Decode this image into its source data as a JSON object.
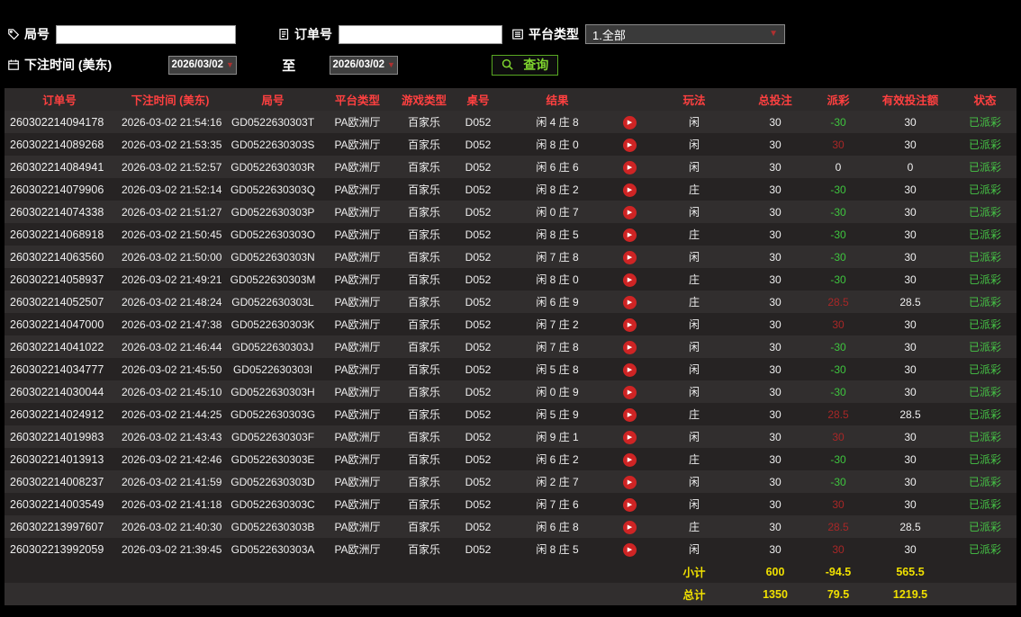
{
  "colors": {
    "header_text": "#ff4040",
    "win": "#a82727",
    "loss": "#3ec43e",
    "status": "#46c446",
    "footer": "#f0e000",
    "accent_green": "#7fd42e",
    "arrow_red": "#b03030"
  },
  "icons": {
    "dropdown_arrow": "▼",
    "play": "▶"
  },
  "filters": {
    "round": {
      "label": "局号",
      "value": ""
    },
    "order": {
      "label": "订单号",
      "value": ""
    },
    "platform": {
      "label": "平台类型",
      "value": "1.全部"
    },
    "bet_time": {
      "label": "下注时间 (美东)",
      "from": "2026/03/02",
      "to_label": "至",
      "to": "2026/03/02"
    },
    "query_label": "查询"
  },
  "table": {
    "headers": [
      "订单号",
      "下注时间 (美东)",
      "局号",
      "平台类型",
      "游戏类型",
      "桌号",
      "结果",
      "玩法",
      "总投注",
      "派彩",
      "有效投注额",
      "状态"
    ],
    "rows": [
      {
        "order": "260302214094178",
        "time": "2026-03-02 21:54:16",
        "round": "GD0522630303T",
        "platform": "PA欧洲厅",
        "game": "百家乐",
        "table": "D052",
        "result": "闲 4 庄 8",
        "play": "闲",
        "bet": "30",
        "payout": "-30",
        "valid": "30",
        "status": "已派彩"
      },
      {
        "order": "260302214089268",
        "time": "2026-03-02 21:53:35",
        "round": "GD0522630303S",
        "platform": "PA欧洲厅",
        "game": "百家乐",
        "table": "D052",
        "result": "闲 8 庄 0",
        "play": "闲",
        "bet": "30",
        "payout": "30",
        "valid": "30",
        "status": "已派彩"
      },
      {
        "order": "260302214084941",
        "time": "2026-03-02 21:52:57",
        "round": "GD0522630303R",
        "platform": "PA欧洲厅",
        "game": "百家乐",
        "table": "D052",
        "result": "闲 6 庄 6",
        "play": "闲",
        "bet": "30",
        "payout": "0",
        "valid": "0",
        "status": "已派彩"
      },
      {
        "order": "260302214079906",
        "time": "2026-03-02 21:52:14",
        "round": "GD0522630303Q",
        "platform": "PA欧洲厅",
        "game": "百家乐",
        "table": "D052",
        "result": "闲 8 庄 2",
        "play": "庄",
        "bet": "30",
        "payout": "-30",
        "valid": "30",
        "status": "已派彩"
      },
      {
        "order": "260302214074338",
        "time": "2026-03-02 21:51:27",
        "round": "GD0522630303P",
        "platform": "PA欧洲厅",
        "game": "百家乐",
        "table": "D052",
        "result": "闲 0 庄 7",
        "play": "闲",
        "bet": "30",
        "payout": "-30",
        "valid": "30",
        "status": "已派彩"
      },
      {
        "order": "260302214068918",
        "time": "2026-03-02 21:50:45",
        "round": "GD0522630303O",
        "platform": "PA欧洲厅",
        "game": "百家乐",
        "table": "D052",
        "result": "闲 8 庄 5",
        "play": "庄",
        "bet": "30",
        "payout": "-30",
        "valid": "30",
        "status": "已派彩"
      },
      {
        "order": "260302214063560",
        "time": "2026-03-02 21:50:00",
        "round": "GD0522630303N",
        "platform": "PA欧洲厅",
        "game": "百家乐",
        "table": "D052",
        "result": "闲 7 庄 8",
        "play": "闲",
        "bet": "30",
        "payout": "-30",
        "valid": "30",
        "status": "已派彩"
      },
      {
        "order": "260302214058937",
        "time": "2026-03-02 21:49:21",
        "round": "GD0522630303M",
        "platform": "PA欧洲厅",
        "game": "百家乐",
        "table": "D052",
        "result": "闲 8 庄 0",
        "play": "庄",
        "bet": "30",
        "payout": "-30",
        "valid": "30",
        "status": "已派彩"
      },
      {
        "order": "260302214052507",
        "time": "2026-03-02 21:48:24",
        "round": "GD0522630303L",
        "platform": "PA欧洲厅",
        "game": "百家乐",
        "table": "D052",
        "result": "闲 6 庄 9",
        "play": "庄",
        "bet": "30",
        "payout": "28.5",
        "valid": "28.5",
        "status": "已派彩"
      },
      {
        "order": "260302214047000",
        "time": "2026-03-02 21:47:38",
        "round": "GD0522630303K",
        "platform": "PA欧洲厅",
        "game": "百家乐",
        "table": "D052",
        "result": "闲 7 庄 2",
        "play": "闲",
        "bet": "30",
        "payout": "30",
        "valid": "30",
        "status": "已派彩"
      },
      {
        "order": "260302214041022",
        "time": "2026-03-02 21:46:44",
        "round": "GD0522630303J",
        "platform": "PA欧洲厅",
        "game": "百家乐",
        "table": "D052",
        "result": "闲 7 庄 8",
        "play": "闲",
        "bet": "30",
        "payout": "-30",
        "valid": "30",
        "status": "已派彩"
      },
      {
        "order": "260302214034777",
        "time": "2026-03-02 21:45:50",
        "round": "GD0522630303I",
        "platform": "PA欧洲厅",
        "game": "百家乐",
        "table": "D052",
        "result": "闲 5 庄 8",
        "play": "闲",
        "bet": "30",
        "payout": "-30",
        "valid": "30",
        "status": "已派彩"
      },
      {
        "order": "260302214030044",
        "time": "2026-03-02 21:45:10",
        "round": "GD0522630303H",
        "platform": "PA欧洲厅",
        "game": "百家乐",
        "table": "D052",
        "result": "闲 0 庄 9",
        "play": "闲",
        "bet": "30",
        "payout": "-30",
        "valid": "30",
        "status": "已派彩"
      },
      {
        "order": "260302214024912",
        "time": "2026-03-02 21:44:25",
        "round": "GD0522630303G",
        "platform": "PA欧洲厅",
        "game": "百家乐",
        "table": "D052",
        "result": "闲 5 庄 9",
        "play": "庄",
        "bet": "30",
        "payout": "28.5",
        "valid": "28.5",
        "status": "已派彩"
      },
      {
        "order": "260302214019983",
        "time": "2026-03-02 21:43:43",
        "round": "GD0522630303F",
        "platform": "PA欧洲厅",
        "game": "百家乐",
        "table": "D052",
        "result": "闲 9 庄 1",
        "play": "闲",
        "bet": "30",
        "payout": "30",
        "valid": "30",
        "status": "已派彩"
      },
      {
        "order": "260302214013913",
        "time": "2026-03-02 21:42:46",
        "round": "GD0522630303E",
        "platform": "PA欧洲厅",
        "game": "百家乐",
        "table": "D052",
        "result": "闲 6 庄 2",
        "play": "庄",
        "bet": "30",
        "payout": "-30",
        "valid": "30",
        "status": "已派彩"
      },
      {
        "order": "260302214008237",
        "time": "2026-03-02 21:41:59",
        "round": "GD0522630303D",
        "platform": "PA欧洲厅",
        "game": "百家乐",
        "table": "D052",
        "result": "闲 2 庄 7",
        "play": "闲",
        "bet": "30",
        "payout": "-30",
        "valid": "30",
        "status": "已派彩"
      },
      {
        "order": "260302214003549",
        "time": "2026-03-02 21:41:18",
        "round": "GD0522630303C",
        "platform": "PA欧洲厅",
        "game": "百家乐",
        "table": "D052",
        "result": "闲 7 庄 6",
        "play": "闲",
        "bet": "30",
        "payout": "30",
        "valid": "30",
        "status": "已派彩"
      },
      {
        "order": "260302213997607",
        "time": "2026-03-02 21:40:30",
        "round": "GD0522630303B",
        "platform": "PA欧洲厅",
        "game": "百家乐",
        "table": "D052",
        "result": "闲 6 庄 8",
        "play": "庄",
        "bet": "30",
        "payout": "28.5",
        "valid": "28.5",
        "status": "已派彩"
      },
      {
        "order": "260302213992059",
        "time": "2026-03-02 21:39:45",
        "round": "GD0522630303A",
        "platform": "PA欧洲厅",
        "game": "百家乐",
        "table": "D052",
        "result": "闲 8 庄 5",
        "play": "闲",
        "bet": "30",
        "payout": "30",
        "valid": "30",
        "status": "已派彩"
      }
    ],
    "subtotal": {
      "label": "小计",
      "bet": "600",
      "payout": "-94.5",
      "valid": "565.5"
    },
    "total": {
      "label": "总计",
      "bet": "1350",
      "payout": "79.5",
      "valid": "1219.5"
    }
  }
}
